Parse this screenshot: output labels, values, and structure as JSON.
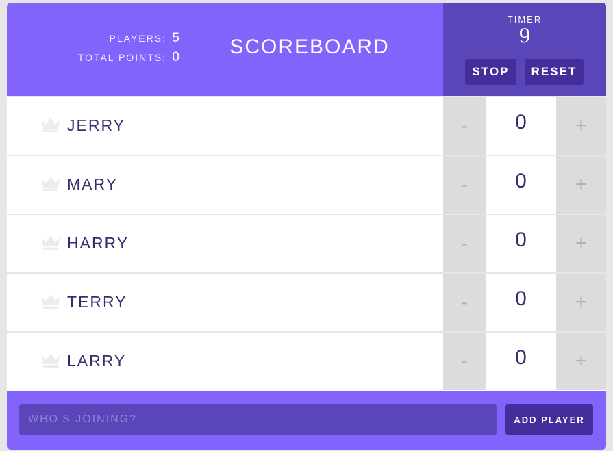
{
  "colors": {
    "header_bg": "#8264fc",
    "timer_bg": "#5a45b9",
    "button_bg": "#432e9c",
    "name_text": "#3b2a6e",
    "counter_bg": "#dcdcdc",
    "page_bg": "#e6e6e6"
  },
  "header": {
    "stats": {
      "players_label": "Players:",
      "players_value": "5",
      "total_label": "Total Points:",
      "total_value": "0"
    },
    "title": "Scoreboard",
    "timer": {
      "label": "Timer",
      "value": "9",
      "stop_label": "Stop",
      "reset_label": "Reset"
    }
  },
  "players": [
    {
      "name": "Jerry",
      "score": "0",
      "minus": "-",
      "plus": "+",
      "icon": "crown-icon"
    },
    {
      "name": "Mary",
      "score": "0",
      "minus": "-",
      "plus": "+",
      "icon": "crown-icon"
    },
    {
      "name": "Harry",
      "score": "0",
      "minus": "-",
      "plus": "+",
      "icon": "crown-icon"
    },
    {
      "name": "Terry",
      "score": "0",
      "minus": "-",
      "plus": "+",
      "icon": "crown-icon"
    },
    {
      "name": "Larry",
      "score": "0",
      "minus": "-",
      "plus": "+",
      "icon": "crown-icon"
    }
  ],
  "footer": {
    "input_placeholder": "Who's joining?",
    "input_value": "",
    "add_label": "Add Player"
  }
}
